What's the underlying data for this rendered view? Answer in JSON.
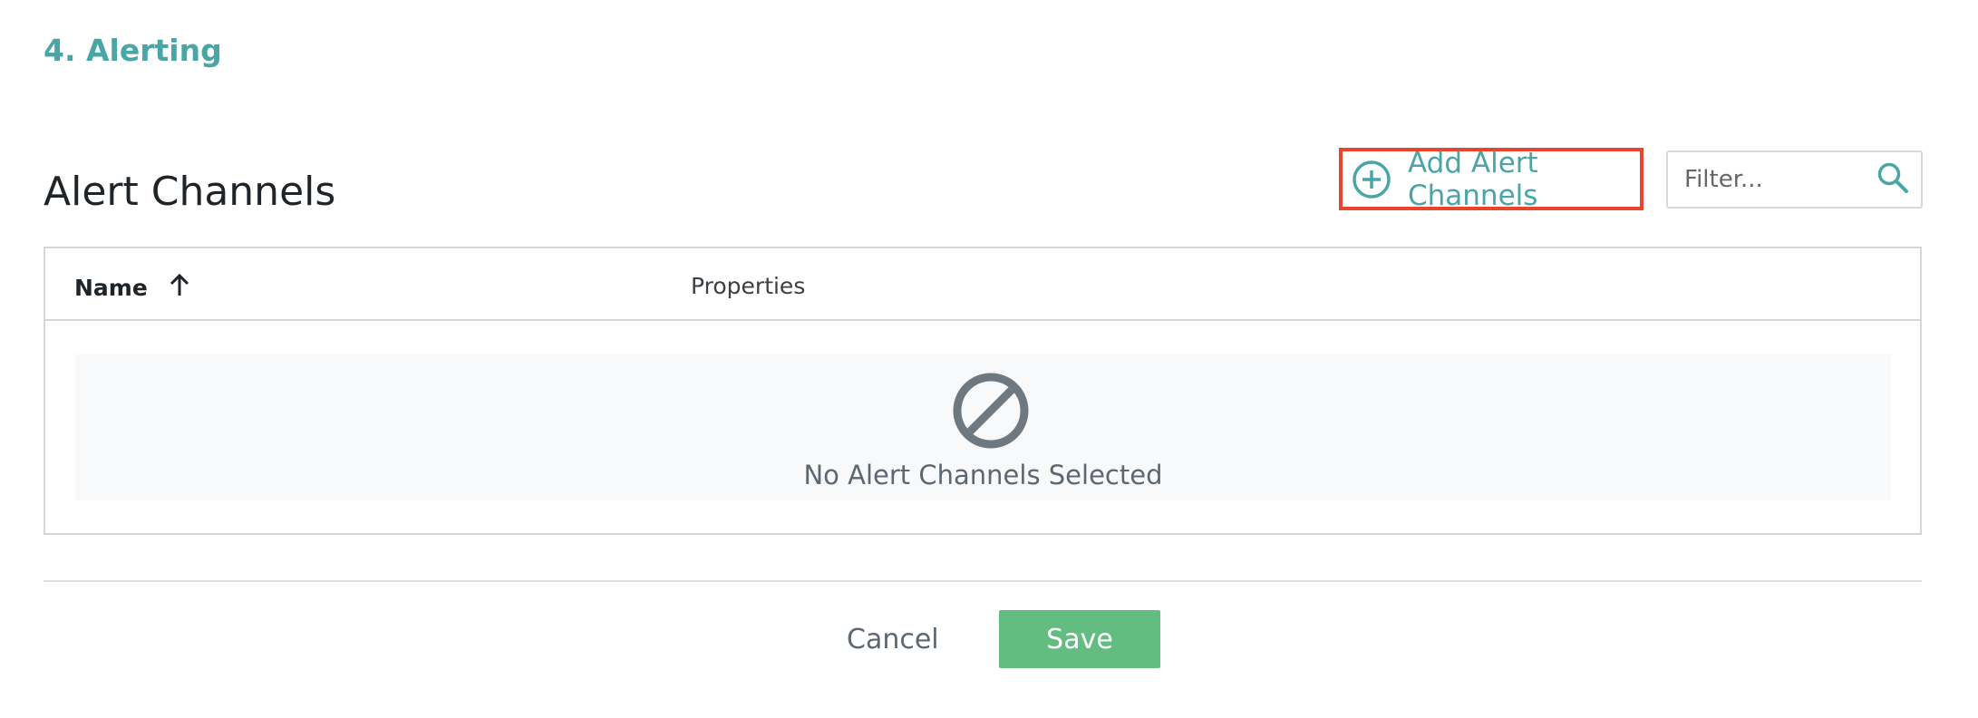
{
  "section": {
    "title": "4. Alerting"
  },
  "panel": {
    "title": "Alert Channels",
    "add_button": {
      "label": "Add Alert Channels",
      "icon": "plus-circle-icon"
    },
    "filter": {
      "placeholder": "Filter...",
      "value": "",
      "icon": "search-icon"
    }
  },
  "table": {
    "columns": [
      {
        "label": "Name",
        "sort": "ascending",
        "sort_icon": "arrow-up-icon"
      },
      {
        "label": "Properties"
      }
    ],
    "rows": [],
    "empty_state": {
      "icon": "no-entry-icon",
      "message": "No Alert Channels Selected"
    }
  },
  "footer": {
    "cancel_label": "Cancel",
    "save_label": "Save"
  },
  "colors": {
    "accent": "#4aa6a6",
    "highlight_border": "#e8452c",
    "save_green": "#63bd80",
    "muted_text": "#5d6771",
    "empty_bg": "#f7f9fa"
  }
}
